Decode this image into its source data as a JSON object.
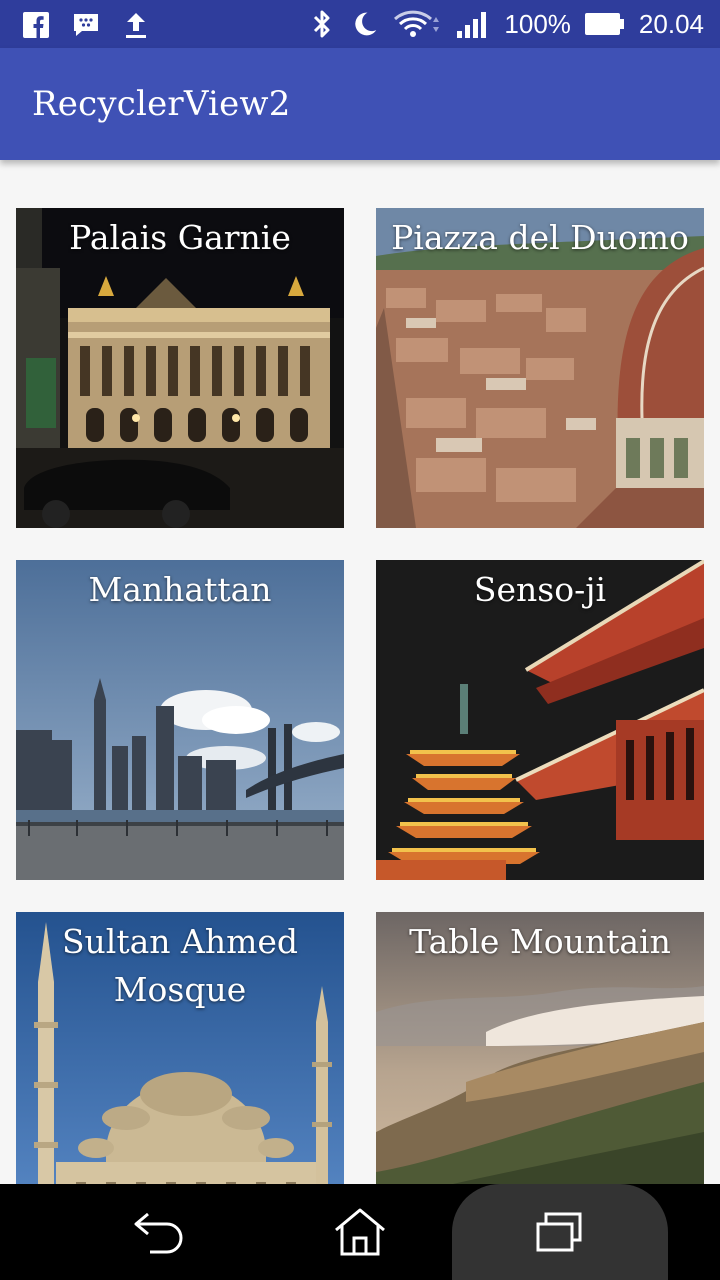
{
  "status_bar": {
    "battery_text": "100%",
    "time_text": "20.04",
    "left_icons": [
      "facebook-icon",
      "messenger-icon",
      "upload-icon"
    ],
    "right_icons": [
      "bluetooth-icon",
      "do-not-disturb-moon-icon",
      "wifi-icon",
      "signal-icon",
      "battery-icon"
    ]
  },
  "app_bar": {
    "title": "RecyclerView2",
    "color": "#3f51b5"
  },
  "places": [
    {
      "name": "Palais Garnie"
    },
    {
      "name": "Piazza del Duomo"
    },
    {
      "name": "Manhattan"
    },
    {
      "name": "Senso-ji"
    },
    {
      "name": "Sultan Ahmed Mosque"
    },
    {
      "name": "Table Mountain"
    }
  ],
  "nav_bar": {
    "icons": [
      "back-icon",
      "home-icon",
      "recents-icon"
    ]
  }
}
